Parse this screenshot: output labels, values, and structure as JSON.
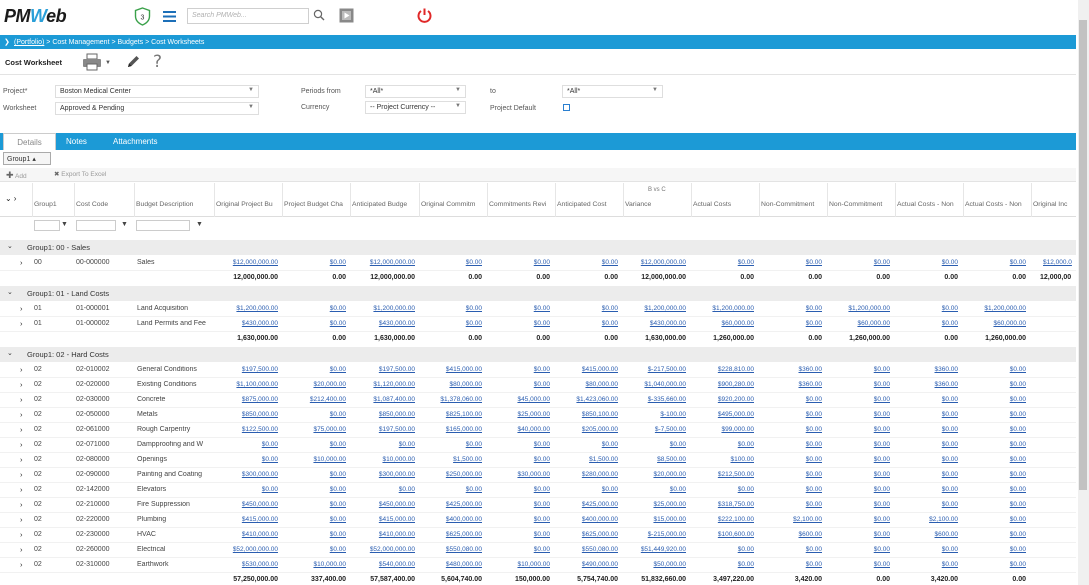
{
  "header": {
    "logo_left": "PM",
    "logo_mid": "W",
    "logo_right": "eb",
    "shield_count": "3",
    "search_placeholder": "Search PMWeb..."
  },
  "breadcrumb": {
    "portfolio": "(Portfolio)",
    "rest": " > Cost Management > Budgets > Cost Worksheets"
  },
  "page": {
    "title": "Cost Worksheet"
  },
  "form": {
    "project_label": "Project*",
    "project_value": "Boston Medical Center",
    "worksheet_label": "Worksheet",
    "worksheet_value": "Approved & Pending",
    "periods_from_label": "Periods from",
    "periods_from_value": "*All*",
    "currency_label": "Currency",
    "currency_value": "-- Project Currency --",
    "to_label": "to",
    "to_value": "*All*",
    "project_default_label": "Project Default"
  },
  "tabs": {
    "details": "Details",
    "notes": "Notes",
    "attachments": "Attachments"
  },
  "grouping": {
    "chip": "Group1"
  },
  "toolbar": {
    "add": "Add",
    "export": "Export To Excel"
  },
  "grid": {
    "bvc": "B vs C",
    "columns": [
      "Group1",
      "Cost Code",
      "Budget Description",
      "Original Project Bu",
      "Project Budget Cha",
      "Anticipated Budge",
      "Original Commitm",
      "Commitments Revi",
      "Anticipated Cost",
      "Variance",
      "Actual Costs",
      "Non-Commitment",
      "Non-Commitment",
      "Actual Costs - Non",
      "Actual Costs - Non",
      "Original Inc"
    ],
    "groups": [
      {
        "label": "Group1: 00 - Sales",
        "rows": [
          {
            "g": "00",
            "code": "00-000000",
            "desc": "Sales",
            "vals": [
              "$12,000,000.00",
              "$0.00",
              "$12,000,000.00",
              "$0.00",
              "$0.00",
              "$0.00",
              "$12,000,000.00",
              "$0.00",
              "$0.00",
              "$0.00",
              "$0.00",
              "$0.00",
              "$12,000.0"
            ]
          }
        ],
        "total": [
          "12,000,000.00",
          "0.00",
          "12,000,000.00",
          "0.00",
          "0.00",
          "0.00",
          "12,000,000.00",
          "0.00",
          "0.00",
          "0.00",
          "0.00",
          "0.00",
          "12,000,00"
        ]
      },
      {
        "label": "Group1: 01 - Land Costs",
        "rows": [
          {
            "g": "01",
            "code": "01-000001",
            "desc": "Land Acquisition",
            "vals": [
              "$1,200,000.00",
              "$0.00",
              "$1,200,000.00",
              "$0.00",
              "$0.00",
              "$0.00",
              "$1,200,000.00",
              "$1,200,000.00",
              "$0.00",
              "$1,200,000.00",
              "$0.00",
              "$1,200,000.00",
              ""
            ]
          },
          {
            "g": "01",
            "code": "01-000002",
            "desc": "Land Permits and Fee",
            "vals": [
              "$430,000.00",
              "$0.00",
              "$430,000.00",
              "$0.00",
              "$0.00",
              "$0.00",
              "$430,000.00",
              "$60,000.00",
              "$0.00",
              "$60,000.00",
              "$0.00",
              "$60,000.00",
              ""
            ]
          }
        ],
        "total": [
          "1,630,000.00",
          "0.00",
          "1,630,000.00",
          "0.00",
          "0.00",
          "0.00",
          "1,630,000.00",
          "1,260,000.00",
          "0.00",
          "1,260,000.00",
          "0.00",
          "1,260,000.00",
          ""
        ]
      },
      {
        "label": "Group1: 02 - Hard Costs",
        "rows": [
          {
            "g": "02",
            "code": "02-010002",
            "desc": "General Conditions",
            "vals": [
              "$197,500.00",
              "$0.00",
              "$197,500.00",
              "$415,000.00",
              "$0.00",
              "$415,000.00",
              "$-217,500.00",
              "$228,810.00",
              "$360.00",
              "$0.00",
              "$360.00",
              "$0.00",
              ""
            ]
          },
          {
            "g": "02",
            "code": "02-020000",
            "desc": "Existing Conditions",
            "vals": [
              "$1,100,000.00",
              "$20,000.00",
              "$1,120,000.00",
              "$80,000.00",
              "$0.00",
              "$80,000.00",
              "$1,040,000.00",
              "$900,280.00",
              "$360.00",
              "$0.00",
              "$360.00",
              "$0.00",
              ""
            ]
          },
          {
            "g": "02",
            "code": "02-030000",
            "desc": "Concrete",
            "vals": [
              "$875,000.00",
              "$212,400.00",
              "$1,087,400.00",
              "$1,378,060.00",
              "$45,000.00",
              "$1,423,060.00",
              "$-335,660.00",
              "$920,200.00",
              "$0.00",
              "$0.00",
              "$0.00",
              "$0.00",
              ""
            ]
          },
          {
            "g": "02",
            "code": "02-050000",
            "desc": "Metals",
            "vals": [
              "$850,000.00",
              "$0.00",
              "$850,000.00",
              "$825,100.00",
              "$25,000.00",
              "$850,100.00",
              "$-100.00",
              "$495,000.00",
              "$0.00",
              "$0.00",
              "$0.00",
              "$0.00",
              ""
            ]
          },
          {
            "g": "02",
            "code": "02-061000",
            "desc": "Rough Carpentry",
            "vals": [
              "$122,500.00",
              "$75,000.00",
              "$197,500.00",
              "$165,000.00",
              "$40,000.00",
              "$205,000.00",
              "$-7,500.00",
              "$99,000.00",
              "$0.00",
              "$0.00",
              "$0.00",
              "$0.00",
              ""
            ]
          },
          {
            "g": "02",
            "code": "02-071000",
            "desc": "Dampproofing and W",
            "vals": [
              "$0.00",
              "$0.00",
              "$0.00",
              "$0.00",
              "$0.00",
              "$0.00",
              "$0.00",
              "$0.00",
              "$0.00",
              "$0.00",
              "$0.00",
              "$0.00",
              ""
            ]
          },
          {
            "g": "02",
            "code": "02-080000",
            "desc": "Openings",
            "vals": [
              "$0.00",
              "$10,000.00",
              "$10,000.00",
              "$1,500.00",
              "$0.00",
              "$1,500.00",
              "$8,500.00",
              "$100.00",
              "$0.00",
              "$0.00",
              "$0.00",
              "$0.00",
              ""
            ]
          },
          {
            "g": "02",
            "code": "02-090000",
            "desc": "Painting and Coating",
            "vals": [
              "$300,000.00",
              "$0.00",
              "$300,000.00",
              "$250,000.00",
              "$30,000.00",
              "$280,000.00",
              "$20,000.00",
              "$212,500.00",
              "$0.00",
              "$0.00",
              "$0.00",
              "$0.00",
              ""
            ]
          },
          {
            "g": "02",
            "code": "02-142000",
            "desc": "Elevators",
            "vals": [
              "$0.00",
              "$0.00",
              "$0.00",
              "$0.00",
              "$0.00",
              "$0.00",
              "$0.00",
              "$0.00",
              "$0.00",
              "$0.00",
              "$0.00",
              "$0.00",
              ""
            ]
          },
          {
            "g": "02",
            "code": "02-210000",
            "desc": "Fire Suppression",
            "vals": [
              "$450,000.00",
              "$0.00",
              "$450,000.00",
              "$425,000.00",
              "$0.00",
              "$425,000.00",
              "$25,000.00",
              "$318,750.00",
              "$0.00",
              "$0.00",
              "$0.00",
              "$0.00",
              ""
            ]
          },
          {
            "g": "02",
            "code": "02-220000",
            "desc": "Plumbing",
            "vals": [
              "$415,000.00",
              "$0.00",
              "$415,000.00",
              "$400,000.00",
              "$0.00",
              "$400,000.00",
              "$15,000.00",
              "$222,100.00",
              "$2,100.00",
              "$0.00",
              "$2,100.00",
              "$0.00",
              ""
            ]
          },
          {
            "g": "02",
            "code": "02-230000",
            "desc": "HVAC",
            "vals": [
              "$410,000.00",
              "$0.00",
              "$410,000.00",
              "$625,000.00",
              "$0.00",
              "$625,000.00",
              "$-215,000.00",
              "$100,600.00",
              "$600.00",
              "$0.00",
              "$600.00",
              "$0.00",
              ""
            ]
          },
          {
            "g": "02",
            "code": "02-260000",
            "desc": "Electrical",
            "vals": [
              "$52,000,000.00",
              "$0.00",
              "$52,000,000.00",
              "$550,080.00",
              "$0.00",
              "$550,080.00",
              "$51,449,920.00",
              "$0.00",
              "$0.00",
              "$0.00",
              "$0.00",
              "$0.00",
              ""
            ]
          },
          {
            "g": "02",
            "code": "02-310000",
            "desc": "Earthwork",
            "vals": [
              "$530,000.00",
              "$10,000.00",
              "$540,000.00",
              "$480,000.00",
              "$10,000.00",
              "$490,000.00",
              "$50,000.00",
              "$0.00",
              "$0.00",
              "$0.00",
              "$0.00",
              "$0.00",
              ""
            ]
          }
        ],
        "total": [
          "57,250,000.00",
          "337,400.00",
          "57,587,400.00",
          "5,604,740.00",
          "150,000.00",
          "5,754,740.00",
          "51,832,660.00",
          "3,497,220.00",
          "3,420.00",
          "0.00",
          "3,420.00",
          "0.00",
          ""
        ]
      }
    ]
  }
}
